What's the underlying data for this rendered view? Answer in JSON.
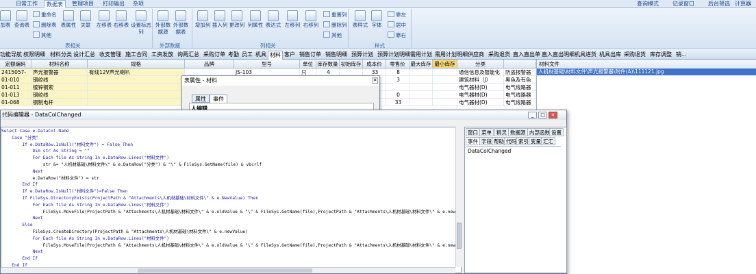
{
  "menubar": {
    "tabs": [
      "日常工作",
      "数据表",
      "管理项目",
      "打印输出",
      "杂项"
    ],
    "active_tab": "数据表",
    "right_links": [
      "查询模式",
      "记录窗口",
      "后台筛选",
      "计算器"
    ]
  },
  "ribbon": {
    "buttons": [
      "加表",
      "查询表",
      "表属性",
      "关联",
      "左移表",
      "右移表",
      "设置标志列",
      "外部数据源",
      "外部数据表",
      "增加列",
      "插入列",
      "更改列",
      "列属性",
      "表达式",
      "左移列",
      "右移列",
      "表样式",
      "字体"
    ],
    "small_buttons": [
      "重命名",
      "删除表",
      "其他",
      "重置列",
      "删除列",
      "其他",
      "靠左",
      "居中",
      "靠右"
    ],
    "groups": [
      "表相关",
      "外部数据",
      "列相关",
      "样式"
    ]
  },
  "tabbar": {
    "tabs": [
      "功能导航",
      "权限明细",
      "材料分类",
      "设计汇总",
      "收支管理",
      "施工合同",
      "工资发放",
      "询两汇总",
      "采购订单",
      "考勤",
      "员工",
      "机具",
      "材料",
      "客户",
      "销售订单",
      "销售明细",
      "预算计划",
      "预算计划明细",
      "需用计划",
      "需用计划明细",
      "供应商",
      "采购退货",
      "直入直出单",
      "直入直出明细",
      "机具进货",
      "机具出库",
      "采购退货",
      "库存调整",
      "销..."
    ],
    "active": "材料"
  },
  "grid": {
    "headers": [
      "定额编码",
      "材料名称",
      "规格",
      "品牌",
      "型号",
      "单位",
      "库存数量",
      "初始库存",
      "成本价",
      "零售价",
      "最大库存",
      "最小库存",
      "分类",
      ""
    ],
    "selected_header": "最小库存",
    "rows": [
      [
        "2415057-",
        "声光报警器",
        "有线12V声光喇叭",
        "",
        "JS-103",
        "只",
        "4",
        "",
        "33",
        "8",
        "",
        "",
        "通信信息及智能化",
        "防盗报警器"
      ],
      [
        "01-010",
        "钢绞线",
        "",
        "",
        "",
        "",
        "",
        "",
        "5",
        "3",
        "",
        "",
        "建筑材料（J）",
        "黑色及有色"
      ],
      [
        "01-011",
        "镀锌钢索",
        "",
        "",
        "",
        "",
        "",
        "",
        "1",
        "",
        "",
        "",
        "电气器材(D)",
        "电气线路器"
      ],
      [
        "01-013",
        "钢绞线",
        "",
        "",
        "",
        "",
        "",
        "",
        "0",
        "0",
        "",
        "",
        "电气器材(D)",
        "电气线路器"
      ],
      [
        "01-068",
        "钢制电杆",
        "",
        "",
        "",
        "",
        "",
        "",
        "4",
        "33",
        "",
        "",
        "电气器材(D)",
        "电气线路器"
      ]
    ]
  },
  "right_panel": {
    "header": "材料文件",
    "selected_value": "人机材基础\\材料文件\\声光报警器\\附件(A)\\111121.jpg"
  },
  "prop_window": {
    "title": "表属性 - 材料",
    "tabs": [
      "属性",
      "事件"
    ],
    "active_tab": "事件",
    "row_label": "人编辑"
  },
  "editor": {
    "title": "代码编辑器 - DataColChanged",
    "side_tabs_row1": [
      "窗口",
      "菜单",
      "精灵",
      "数据源",
      "内部函数",
      "设置"
    ],
    "side_tabs_row2": [
      "事件",
      "字段",
      "帮助",
      "代码",
      "索引",
      "变量",
      "汇汇"
    ],
    "side_active": "事件",
    "side_item": "DataColChanged",
    "code_lines": [
      "Select Case e.DataCol.Name",
      "    Case \"分类\"",
      "        If e.DataRow.IsNull(\"材料文件\") = False Then",
      "            Dim str As String = \"\"",
      "            For Each file As String In e.DataRow.Lines(\"材料文件\")",
      "                str &= \"人机材基础\\材料文件\\\" & e.DataRow(\"分类\") & \"\\\" & FileSys.GetName(file) & vbcrlf",
      "            Next",
      "            e.DataRow(\"材料文件\") = str",
      "        End If",
      "        If e.DataRow.IsNull(\"材料文件\")=False Then",
      "        If FileSys.DirectoryExists(ProjectPath & \"Attachments\\人机材基础\\材料文件\\\" & e.NewValue) Then",
      "            For Each file As String In e.DataRow.Lines(\"材料文件\")",
      "                FileSys.MoveFile(ProjectPath & \"Attachments\\人机材基础\\材料文件\\\" & e.oldValue & \"\\\" & FileSys.GetName(file),ProjectPath & \"Attachments\\人机材基础\\材料文件\\\" & e.newValue",
      "            Next",
      "        Else",
      "            FileSys.CreateDirectory(ProjectPath & \"Attachments\\人机材基础\\材料文件\\\" & e.newValue)",
      "            For Each file As String In e.DataRow.Lines(\"材料文件\")",
      "                FileSys.MoveFile(ProjectPath & \"Attachments\\人机材基础\\材料文件\\\" & e.oldValue & \"\\\" & FileSys.GetName(file),ProjectPath & \"Attachments\\人机材基础\\材料文件\\\" & e.newValue",
      "            Next",
      "        End If",
      "    End If"
    ]
  },
  "colors": {
    "ribbon_text": "#15428b",
    "selection": "#3f73c9",
    "header_highlight": "#f7d778",
    "keyword": "#0000ff",
    "string": "#a31515"
  }
}
